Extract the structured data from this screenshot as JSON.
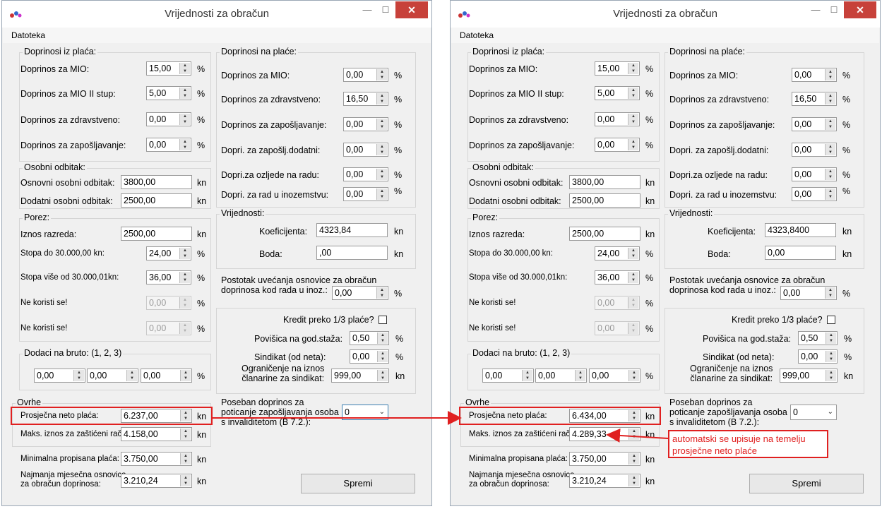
{
  "windows": [
    {
      "title": "Vrijednosti za obračun",
      "menu": "Datoteka",
      "doprinosi_iz": {
        "title": "Doprinosi iz plaća:",
        "rows": [
          {
            "label": "Doprinos za MIO:",
            "value": "15,00",
            "unit": "%"
          },
          {
            "label": "Doprinos za MIO II stup:",
            "value": "5,00",
            "unit": "%"
          },
          {
            "label": "Doprinos za zdravstveno:",
            "value": "0,00",
            "unit": "%"
          },
          {
            "label": "Doprinos za zapošljavanje:",
            "value": "0,00",
            "unit": "%"
          }
        ]
      },
      "odbitak": {
        "title": "Osobni odbitak:",
        "rows": [
          {
            "label": "Osnovni osobni odbitak:",
            "value": "3800,00",
            "unit": "kn"
          },
          {
            "label": "Dodatni osobni odbitak:",
            "value": "2500,00",
            "unit": "kn"
          }
        ]
      },
      "porez": {
        "title": "Porez:",
        "iznos_label": "Iznos razreda:",
        "iznos_value": "2500,00",
        "iznos_unit": "kn",
        "rows": [
          {
            "label": "Stopa do 30.000,00 kn:",
            "value": "24,00",
            "unit": "%"
          },
          {
            "label": "Stopa više od 30.000,01kn:",
            "value": "36,00",
            "unit": "%"
          },
          {
            "label": "Ne koristi se!",
            "value": "0,00",
            "unit": "%"
          },
          {
            "label": "Ne koristi se!",
            "value": "0,00",
            "unit": "%"
          }
        ]
      },
      "dodaci": {
        "title": "Dodaci na bruto: (1, 2, 3)",
        "values": [
          "0,00",
          "0,00",
          "0,00"
        ],
        "unit": "%"
      },
      "ovrhe": {
        "title": "Ovrhe",
        "prosjecna_label": "Prosječna neto plaća:",
        "prosjecna_value": "6.237,00",
        "prosjecna_unit": "kn",
        "maks_label": "Maks. iznos za zaštićeni rač.:",
        "maks_value": "4.158,00",
        "maks_unit": "kn"
      },
      "minimalna": {
        "label": "Minimalna propisana plaća:",
        "value": "3.750,00",
        "unit": "kn"
      },
      "najmanja": {
        "label1": "Najmanja mjesečna osnovica",
        "label2": "za obračun doprinosa:",
        "value": "3.210,24",
        "unit": "kn"
      },
      "doprinosi_na": {
        "title": "Doprinosi na plaće:",
        "rows": [
          {
            "label": "Doprinos za MIO:",
            "value": "0,00",
            "unit": "%"
          },
          {
            "label": "Doprinos za zdravstveno:",
            "value": "16,50",
            "unit": "%"
          },
          {
            "label": "Doprinos za zapošljavanje:",
            "value": "0,00",
            "unit": "%"
          },
          {
            "label": "Dopri. za zapošlj.dodatni:",
            "value": "0,00",
            "unit": "%"
          },
          {
            "label": "Dopri.za ozljede na radu:",
            "value": "0,00",
            "unit": "%"
          },
          {
            "label": "Dopri. za rad u inozemstvu:",
            "value": "0,00",
            "unit": "%"
          }
        ]
      },
      "vrijednosti": {
        "title": "Vrijednosti:",
        "koef_label": "Koeficijenta:",
        "koef_value": "4323,84",
        "koef_unit": "kn",
        "boda_label": "Boda:",
        "boda_value": ",00",
        "boda_unit": "kn"
      },
      "postotak": {
        "label1": "Postotak uvećanja osnovice za obračun",
        "label2": "doprinosa kod rada u inoz.:",
        "value": "0,00",
        "unit": "%"
      },
      "kredit": {
        "kredit_label": "Kredit preko 1/3 plaće?",
        "povisica_label": "Povišica na god.staža:",
        "povisica_value": "0,50",
        "povisica_unit": "%",
        "sindikat_label": "Sindikat (od neta):",
        "sindikat_value": "0,00",
        "sindikat_unit": "%",
        "ogr_label1": "Ograničenje na iznos",
        "ogr_label2": "članarine za sindikat:",
        "ogr_value": "999,00",
        "ogr_unit": "kn"
      },
      "poseban": {
        "label1": "Poseban doprinos za",
        "label2": "poticanje zapošljavanja osoba",
        "label3": "s invaliditetom (B 7.2.):",
        "value": "0"
      },
      "spremi": "Spremi"
    },
    {
      "title": "Vrijednosti za obračun",
      "menu": "Datoteka",
      "doprinosi_iz": {
        "title": "Doprinosi iz plaća:",
        "rows": [
          {
            "label": "Doprinos za MIO:",
            "value": "15,00",
            "unit": "%"
          },
          {
            "label": "Doprinos za MIO II stup:",
            "value": "5,00",
            "unit": "%"
          },
          {
            "label": "Doprinos za zdravstveno:",
            "value": "0,00",
            "unit": "%"
          },
          {
            "label": "Doprinos za zapošljavanje:",
            "value": "0,00",
            "unit": "%"
          }
        ]
      },
      "odbitak": {
        "title": "Osobni odbitak:",
        "rows": [
          {
            "label": "Osnovni osobni odbitak:",
            "value": "3800,00",
            "unit": "kn"
          },
          {
            "label": "Dodatni osobni odbitak:",
            "value": "2500,00",
            "unit": "kn"
          }
        ]
      },
      "porez": {
        "title": "Porez:",
        "iznos_label": "Iznos razreda:",
        "iznos_value": "2500,00",
        "iznos_unit": "kn",
        "rows": [
          {
            "label": "Stopa do 30.000,00 kn:",
            "value": "24,00",
            "unit": "%"
          },
          {
            "label": "Stopa više od 30.000,01kn:",
            "value": "36,00",
            "unit": "%"
          },
          {
            "label": "Ne koristi se!",
            "value": "0,00",
            "unit": "%"
          },
          {
            "label": "Ne koristi se!",
            "value": "0,00",
            "unit": "%"
          }
        ]
      },
      "dodaci": {
        "title": "Dodaci na bruto: (1, 2, 3)",
        "values": [
          "0,00",
          "0,00",
          "0,00"
        ],
        "unit": "%"
      },
      "ovrhe": {
        "title": "Ovrhe",
        "prosjecna_label": "Prosječna neto plaća:",
        "prosjecna_value": "6.434,00",
        "prosjecna_unit": "kn",
        "maks_label": "Maks. iznos za zaštićeni rač.:",
        "maks_value": "4.289,33",
        "maks_unit": "kn"
      },
      "minimalna": {
        "label": "Minimalna propisana plaća:",
        "value": "3.750,00",
        "unit": "kn"
      },
      "najmanja": {
        "label1": "Najmanja mjesečna osnovica",
        "label2": "za obračun doprinosa:",
        "value": "3.210,24",
        "unit": "kn"
      },
      "doprinosi_na": {
        "title": "Doprinosi na plaće:",
        "rows": [
          {
            "label": "Doprinos za MIO:",
            "value": "0,00",
            "unit": "%"
          },
          {
            "label": "Doprinos za zdravstveno:",
            "value": "16,50",
            "unit": "%"
          },
          {
            "label": "Doprinos za zapošljavanje:",
            "value": "0,00",
            "unit": "%"
          },
          {
            "label": "Dopri. za zapošlj.dodatni:",
            "value": "0,00",
            "unit": "%"
          },
          {
            "label": "Dopri.za ozljede na radu:",
            "value": "0,00",
            "unit": "%"
          },
          {
            "label": "Dopri. za rad u inozemstvu:",
            "value": "0,00",
            "unit": "%"
          }
        ]
      },
      "vrijednosti": {
        "title": "Vrijednosti:",
        "koef_label": "Koeficijenta:",
        "koef_value": "4323,8400",
        "koef_unit": "kn",
        "boda_label": "Boda:",
        "boda_value": "0,00",
        "boda_unit": "kn"
      },
      "postotak": {
        "label1": "Postotak uvećanja osnovice za obračun",
        "label2": "doprinosa kod rada u inoz.:",
        "value": "0,00",
        "unit": "%"
      },
      "kredit": {
        "kredit_label": "Kredit preko 1/3 plaće?",
        "povisica_label": "Povišica na god.staža:",
        "povisica_value": "0,50",
        "povisica_unit": "%",
        "sindikat_label": "Sindikat (od neta):",
        "sindikat_value": "0,00",
        "sindikat_unit": "%",
        "ogr_label1": "Ograničenje na iznos",
        "ogr_label2": "članarine za sindikat:",
        "ogr_value": "999,00",
        "ogr_unit": "kn"
      },
      "poseban": {
        "label1": "Poseban doprinos za",
        "label2": "poticanje zapošljavanja osoba",
        "label3": "s invaliditetom (B 7.2.):",
        "value": "0"
      },
      "spremi": "Spremi"
    }
  ],
  "annotation": {
    "line1": "automatski se upisuje na temelju",
    "line2": "prosječne neto plaće",
    "color": "#e02020"
  }
}
